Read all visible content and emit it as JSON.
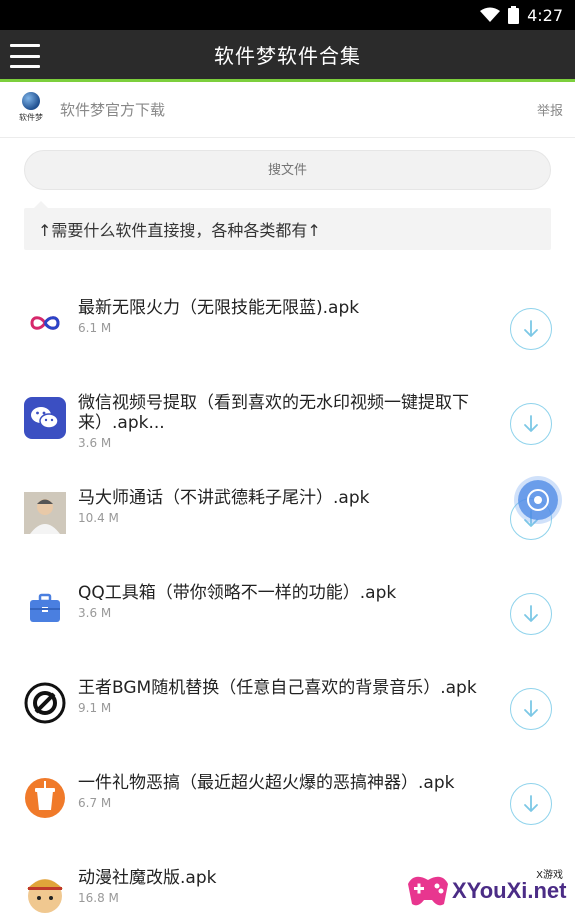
{
  "status_bar": {
    "time": "4:27"
  },
  "app_bar": {
    "title": "软件梦软件合集"
  },
  "source": {
    "logo_text": "软件梦",
    "name": "软件梦官方下载",
    "report_label": "举报"
  },
  "search": {
    "placeholder": "搜文件"
  },
  "hint": {
    "text": "↑需要什么软件直接搜，各种各类都有↑"
  },
  "files": [
    {
      "name": "最新无限火力（无限技能无限蓝).apk",
      "size": "6.1 M",
      "icon": "infinity-icon"
    },
    {
      "name": "微信视频号提取（看到喜欢的无水印视频一键提取下来）.apk...",
      "size": "3.6 M",
      "icon": "wechat-icon"
    },
    {
      "name": "马大师通话（不讲武德耗子尾汁）.apk",
      "size": "10.4 M",
      "icon": "person-photo-icon"
    },
    {
      "name": "QQ工具箱（带你领略不一样的功能）.apk",
      "size": "3.6 M",
      "icon": "toolbox-icon"
    },
    {
      "name": "王者BGM随机替换（任意自己喜欢的背景音乐）.apk",
      "size": "9.1 M",
      "icon": "music-disc-icon"
    },
    {
      "name": "一件礼物恶搞（最近超火超火爆的恶搞神器）.apk",
      "size": "6.7 M",
      "icon": "gift-cup-icon"
    },
    {
      "name": "动漫社魔改版.apk",
      "size": "16.8 M",
      "icon": "anime-avatar-icon"
    }
  ],
  "watermark": {
    "top_text": "X游戏",
    "main_text": "XYouXi.net"
  },
  "colors": {
    "app_bar": "#2b2b2b",
    "accent_line": "#7ccf3c",
    "download_ring": "#8fd3ec",
    "float_button": "#508ce6"
  }
}
